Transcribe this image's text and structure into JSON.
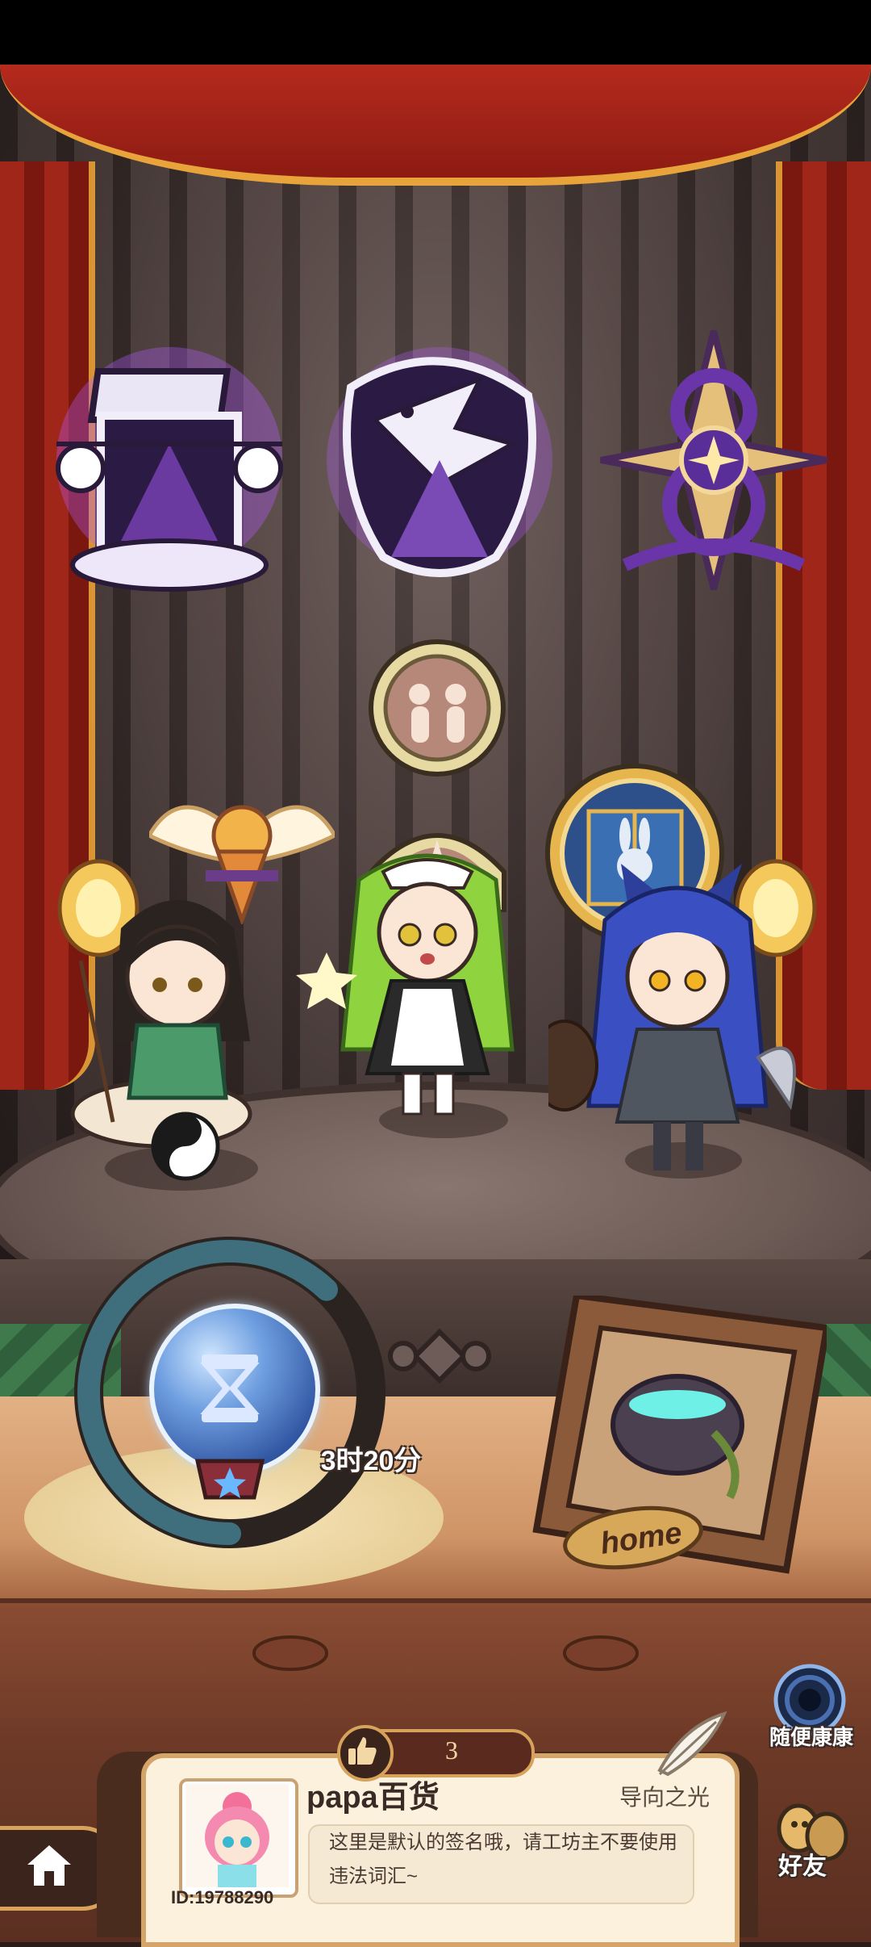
{
  "timer": {
    "remaining_text": "3时20分",
    "progress_fraction": 0.62,
    "ring_color": "#3f6f7d"
  },
  "frame": {
    "label": "home"
  },
  "likes": {
    "count": "3"
  },
  "profile": {
    "username": "papa百货",
    "title": "导向之光",
    "id_text": "ID:19788290",
    "signature": "这里是默认的签名哦，请工坊主不要使用违法词汇~"
  },
  "side_buttons": {
    "random_label": "随便康康",
    "friends_label": "好友"
  },
  "icons": {
    "home": "home-icon",
    "like": "thumbs-up-icon",
    "hourglass": "hourglass-icon",
    "random": "portal-icon",
    "friends": "friends-icon"
  },
  "colors": {
    "accent_gold": "#d7a35a",
    "badge_purple": "#8a3fd0",
    "curtain_red": "#a0261a"
  }
}
